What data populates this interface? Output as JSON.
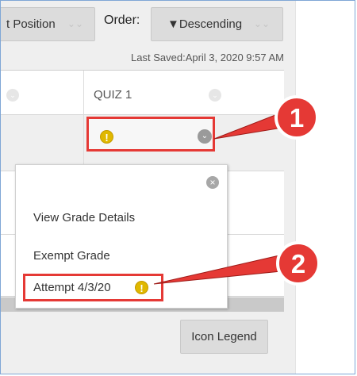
{
  "toolbar": {
    "sort_label": "t Position",
    "order_label": "Order:",
    "order_value": "▼Descending"
  },
  "last_saved": "Last Saved:April 3, 2020 9:57 AM",
  "grid": {
    "column_header": "QUIZ 1"
  },
  "popup": {
    "items": [
      "View Grade Details",
      "Exempt Grade",
      "Attempt 4/3/20"
    ]
  },
  "footer": {
    "legend_label": "Icon Legend"
  },
  "callouts": [
    "1",
    "2"
  ],
  "colors": {
    "callout_red": "#e53935",
    "warning_yellow": "#e0b800"
  },
  "icons": {
    "warning": "exclamation-icon",
    "menu": "chevron-down-icon",
    "close": "close-icon"
  }
}
